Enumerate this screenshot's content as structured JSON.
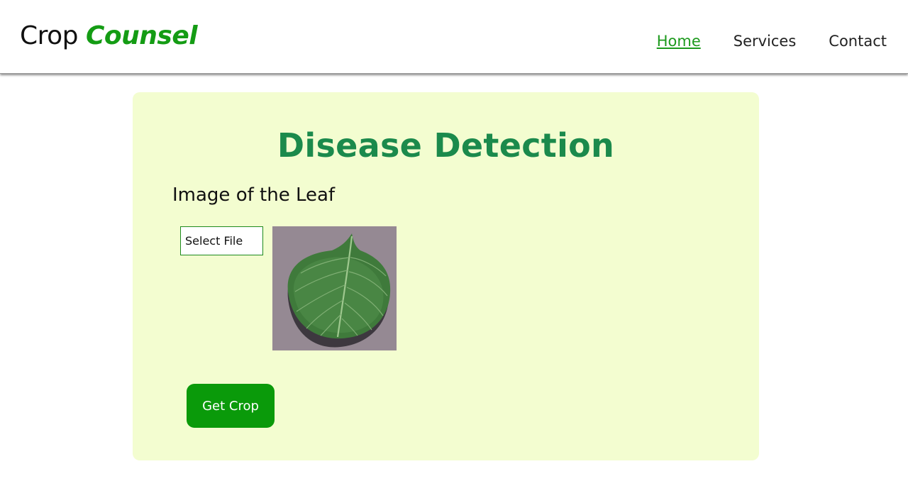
{
  "brand": {
    "primary": "Crop",
    "accent": "Counsel",
    "accent_color": "#149c14"
  },
  "nav": {
    "items": [
      {
        "label": "Home",
        "active": true
      },
      {
        "label": "Services",
        "active": false
      },
      {
        "label": "Contact",
        "active": false
      }
    ]
  },
  "card": {
    "title": "Disease Detection",
    "field_label": "Image of the Leaf",
    "file_button_label": "Select File",
    "preview_icon": "leaf-image",
    "submit_label": "Get Crop"
  },
  "colors": {
    "title": "#1b8a4c",
    "card_bg": "#f3fdd0",
    "button_bg": "#0a9a0a",
    "nav_active": "#1d9a1d"
  }
}
